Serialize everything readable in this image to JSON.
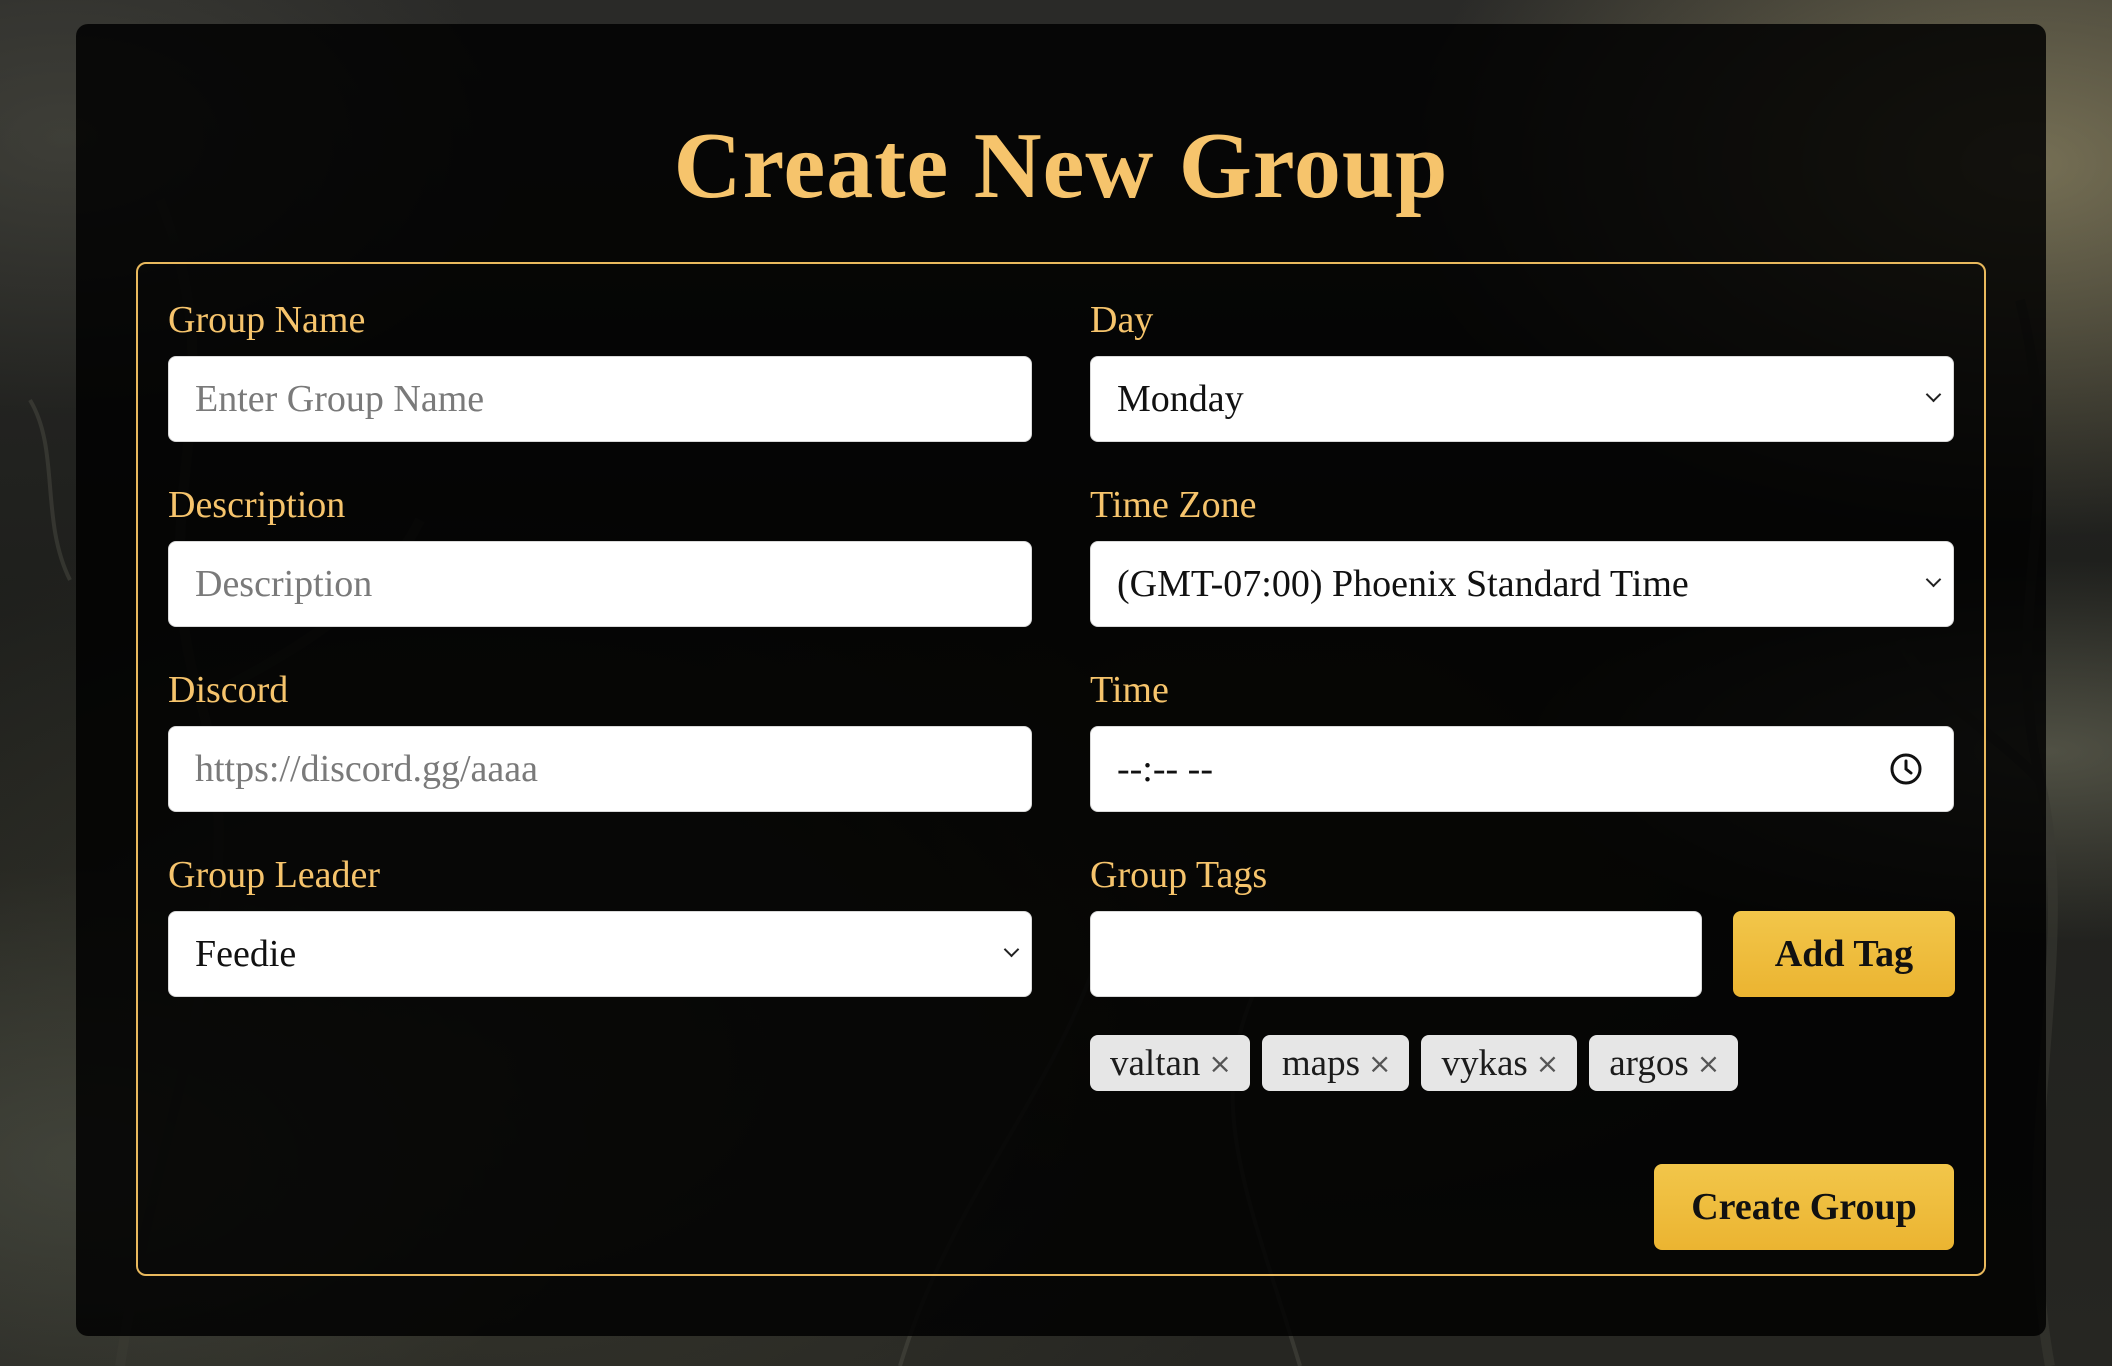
{
  "page": {
    "title": "Create New Group"
  },
  "form": {
    "group_name": {
      "label": "Group Name",
      "placeholder": "Enter Group Name",
      "value": ""
    },
    "description": {
      "label": "Description",
      "placeholder": "Description",
      "value": ""
    },
    "discord": {
      "label": "Discord",
      "placeholder": "https://discord.gg/aaaa",
      "value": ""
    },
    "group_leader": {
      "label": "Group Leader",
      "selected": "Feedie"
    },
    "day": {
      "label": "Day",
      "selected": "Monday"
    },
    "time_zone": {
      "label": "Time Zone",
      "selected": "(GMT-07:00) Phoenix Standard Time"
    },
    "time": {
      "label": "Time",
      "value": "--:-- --"
    },
    "group_tags": {
      "label": "Group Tags",
      "input_value": "",
      "add_label": "Add Tag",
      "tags": [
        "valtan",
        "maps",
        "vykas",
        "argos"
      ],
      "remove_glyph": "×"
    },
    "submit_label": "Create Group"
  },
  "colors": {
    "accent_gold": "#f6c46c",
    "button_gold": "#ebb431",
    "panel_bg": "#000000",
    "chip_bg": "#e6e6e6"
  },
  "icons": {
    "select_arrow": "chevron-down-icon",
    "time_picker": "clock-icon",
    "tag_remove": "close-icon"
  }
}
